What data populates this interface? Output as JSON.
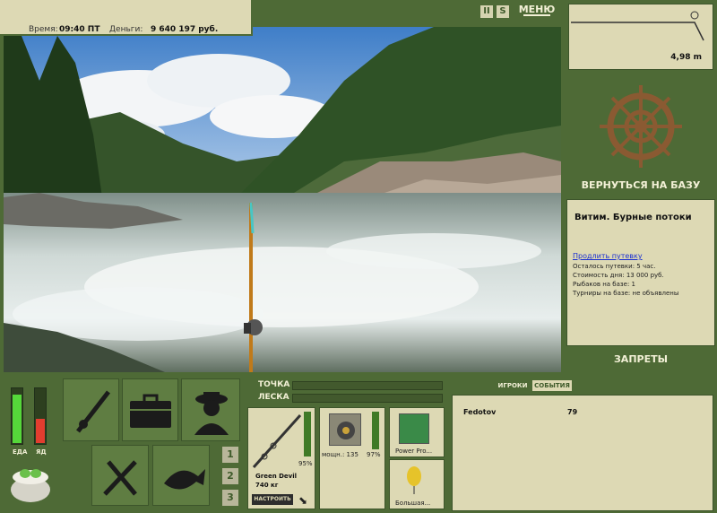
{
  "header": {
    "time_label": "Время:",
    "time_value": "09:40 ПТ",
    "money_label": "Деньги:",
    "money_value": "9 640 197 руб."
  },
  "top_controls": {
    "pause_label": "II",
    "s_label": "S",
    "menu_label": "МЕНЮ"
  },
  "depth": {
    "value": "4,98 m"
  },
  "base": {
    "return_label": "ВЕРНУТЬСЯ НА БАЗУ",
    "location_title": "Витим. Бурные потоки",
    "extend_link": "Продлить путевку",
    "time_left": "Осталось путевки: 5 час.",
    "day_cost": "Стоимость дня: 13 000 руб.",
    "anglers": "Рыбаков на базе: 1",
    "tournaments": "Турниры на базе: не объявлены",
    "bans_label": "ЗАПРЕТЫ"
  },
  "status": {
    "food_label": "ЕДА",
    "poison_label": "ЯД",
    "food_level": 0.9,
    "poison_level": 0.45
  },
  "gauges": {
    "rod_tip_label": "ТОЧКА",
    "line_label": "ЛЕСКА"
  },
  "tackle": {
    "rod_name": "Green Devil",
    "rod_weight": "740 кг",
    "rod_percent": "95%",
    "reel_power": "мощн.: 135",
    "reel_percent": "97%",
    "line_name": "Power Pro...",
    "lure_name": "Большая...",
    "setup_button": "НАСТРОИТЬ"
  },
  "slots": [
    "1",
    "2",
    "3"
  ],
  "players": {
    "tab_players": "ИГРОКИ",
    "tab_events": "СОБЫТИЯ",
    "rows": [
      {
        "name": "Fedotov",
        "score": "79"
      }
    ]
  },
  "colors": {
    "panel_bg": "#ddd9b4",
    "frame_green": "#4e6a36",
    "tile_green": "#5f7d42",
    "text_light": "#f2f0d6"
  }
}
